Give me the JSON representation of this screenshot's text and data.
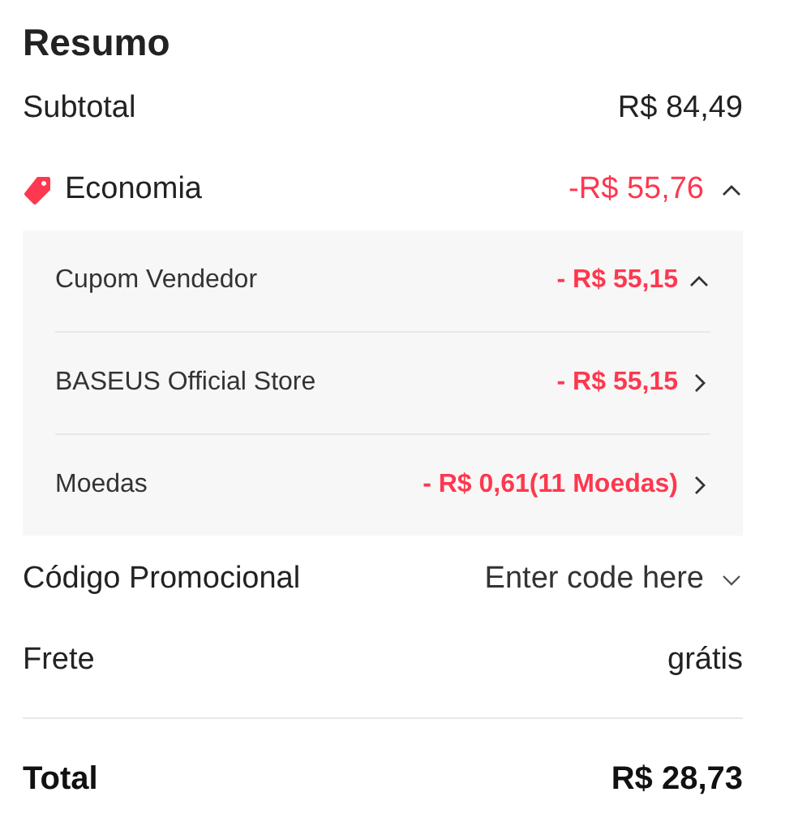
{
  "title": "Resumo",
  "subtotal": {
    "label": "Subtotal",
    "value": "R$ 84,49"
  },
  "savings": {
    "label": "Economia",
    "value": "-R$ 55,76",
    "expanded": true,
    "items": [
      {
        "label": "Cupom Vendedor",
        "value": "- R$ 55,15",
        "kind": "toggle",
        "expanded": true
      },
      {
        "label": "BASEUS Official Store",
        "value": "- R$ 55,15",
        "kind": "link"
      },
      {
        "label": "Moedas",
        "value": "- R$ 0,61(11 Moedas)",
        "kind": "link"
      }
    ]
  },
  "promo_code": {
    "label": "Código Promocional",
    "placeholder": "Enter code here"
  },
  "shipping": {
    "label": "Frete",
    "value": "grátis"
  },
  "total": {
    "label": "Total",
    "value": "R$ 28,73"
  }
}
